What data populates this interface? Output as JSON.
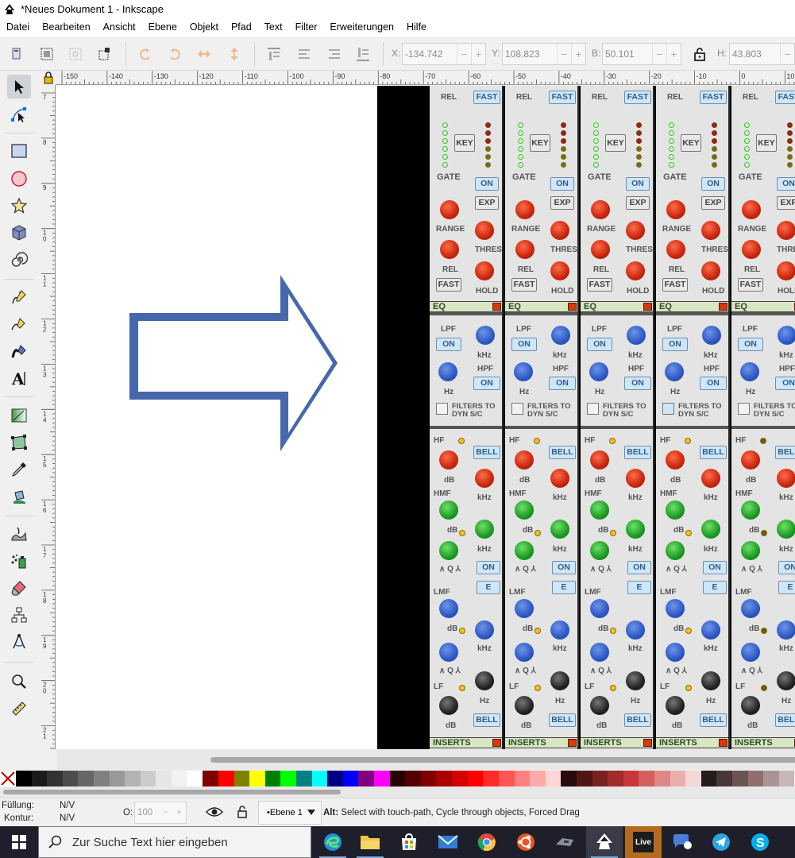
{
  "window": {
    "title": "*Neues Dokument 1 - Inkscape"
  },
  "menu": [
    "Datei",
    "Bearbeiten",
    "Ansicht",
    "Ebene",
    "Objekt",
    "Pfad",
    "Text",
    "Filter",
    "Erweiterungen",
    "Hilfe"
  ],
  "toolbar": {
    "x_label": "X:",
    "x_value": "-134.742",
    "y_label": "Y:",
    "y_value": "108.823",
    "w_label": "B:",
    "w_value": "50.101",
    "h_label": "H:",
    "h_value": "43.803"
  },
  "ruler_top": [
    "-150",
    "-140",
    "-130",
    "-120",
    "-110",
    "-100",
    "-90",
    "-80",
    "-70",
    "-60",
    "-50",
    "-40",
    "-30",
    "-20",
    "-10",
    "0",
    "10"
  ],
  "ruler_left": [
    "7",
    "8",
    "9",
    "1\n0",
    "1\n1",
    "1\n2",
    "1\n3",
    "1\n4",
    "1\n5",
    "1\n6",
    "1\n7",
    "1\n8",
    "1\n9",
    "2\n0",
    "2\n1"
  ],
  "canvas": {
    "arrow_color": "#4667ac",
    "mixer": {
      "rel": "REL",
      "fast": "FAST",
      "key": "KEY",
      "gate": "GATE",
      "on": "ON",
      "exp": "EXP",
      "range": "RANGE",
      "thres": "THRES",
      "hold": "HOLD",
      "eq": "EQ",
      "lpf": "LPF",
      "hpf": "HPF",
      "khz": "kHz",
      "hz": "Hz",
      "filters1": "FILTERS TO",
      "filters2": "DYN S/C",
      "hf": "HF",
      "bell": "BELL",
      "db": "dB",
      "hmf": "HMF",
      "q": "Q",
      "lmf": "LMF",
      "e": "E",
      "lf": "LF",
      "inserts": "INSERTS"
    }
  },
  "palette": [
    "#000000",
    "#1a1a1a",
    "#333333",
    "#4d4d4d",
    "#666666",
    "#808080",
    "#999999",
    "#b3b3b3",
    "#cccccc",
    "#e6e6e6",
    "#f2f2f2",
    "#ffffff",
    "#800000",
    "#ff0000",
    "#808000",
    "#ffff00",
    "#008000",
    "#00ff00",
    "#008080",
    "#00ffff",
    "#000080",
    "#0000ff",
    "#800080",
    "#ff00ff",
    "#2b0000",
    "#550000",
    "#800000",
    "#aa0000",
    "#d40000",
    "#ff0000",
    "#ff2a2a",
    "#ff5555",
    "#ff8080",
    "#ffaaaa",
    "#ffd5d5",
    "#280b0b",
    "#501616",
    "#782121",
    "#a02c2c",
    "#c83737",
    "#d35f5f",
    "#de8787",
    "#e9afaf",
    "#f4d7d7",
    "#241c1c",
    "#483737",
    "#6c5353",
    "#916f6f",
    "#ac9393",
    "#c8b7b7"
  ],
  "status": {
    "fill_label": "Füllung:",
    "fill_value": "N/V",
    "stroke_label": "Kontur:",
    "stroke_value": "N/V",
    "opacity_label": "O:",
    "opacity_value": "100",
    "layer": "•Ebene 1",
    "message_bold": "Alt:",
    "message": " Select with touch-path, Cycle through objects, Forced Drag"
  },
  "taskbar": {
    "search_placeholder": "Zur Suche Text hier eingeben",
    "live_label": "Live"
  }
}
